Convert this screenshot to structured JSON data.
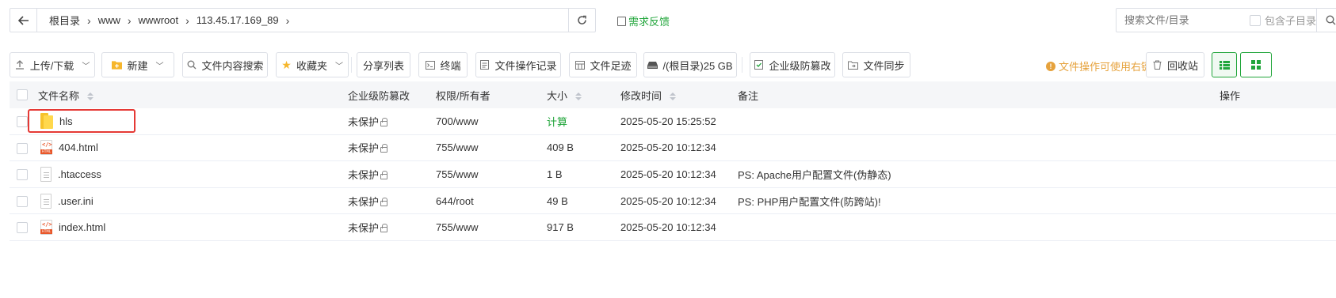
{
  "path": {
    "crumbs": [
      "根目录",
      "www",
      "wwwroot",
      "113.45.17.169_89"
    ],
    "feedback": "需求反馈"
  },
  "search": {
    "placeholder": "搜索文件/目录",
    "include_sub": "包含子目录"
  },
  "toolbar": {
    "upload": "上传/下载",
    "new": "新建",
    "content_search": "文件内容搜索",
    "favorites": "收藏夹",
    "share_list": "分享列表",
    "terminal": "终端",
    "op_log": "文件操作记录",
    "footprint": "文件足迹",
    "disk": "/(根目录)25 GB",
    "tamper": "企业级防篡改",
    "sync": "文件同步",
    "tip": "文件操作可使用右键",
    "recycle": "回收站"
  },
  "table": {
    "headers": {
      "name": "文件名称",
      "tamper": "企业级防篡改",
      "perm": "权限/所有者",
      "size": "大小",
      "mtime": "修改时间",
      "remark": "备注",
      "ops": "操作"
    },
    "rows": [
      {
        "name": "hls",
        "type": "folder",
        "tamper": "未保护",
        "perm": "700/www",
        "size": "计算",
        "mtime": "2025-05-20 15:25:52",
        "remark": ""
      },
      {
        "name": "404.html",
        "type": "html",
        "tamper": "未保护",
        "perm": "755/www",
        "size": "409 B",
        "mtime": "2025-05-20 10:12:34",
        "remark": ""
      },
      {
        "name": ".htaccess",
        "type": "file",
        "tamper": "未保护",
        "perm": "755/www",
        "size": "1 B",
        "mtime": "2025-05-20 10:12:34",
        "remark": "PS: Apache用户配置文件(伪静态)"
      },
      {
        "name": ".user.ini",
        "type": "file",
        "tamper": "未保护",
        "perm": "644/root",
        "size": "49 B",
        "mtime": "2025-05-20 10:12:34",
        "remark": "PS: PHP用户配置文件(防跨站)!"
      },
      {
        "name": "index.html",
        "type": "html",
        "tamper": "未保护",
        "perm": "755/www",
        "size": "917 B",
        "mtime": "2025-05-20 10:12:34",
        "remark": ""
      }
    ]
  },
  "colors": {
    "accent": "#20a53a",
    "warning": "#e6a23c",
    "highlight": "#e53935"
  }
}
